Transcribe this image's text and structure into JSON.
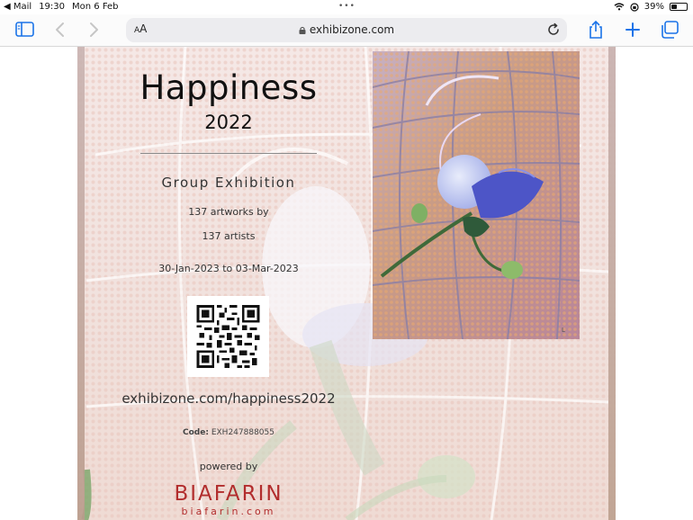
{
  "status_bar": {
    "back_app": "◀ Mail",
    "time": "19:30",
    "date": "Mon 6 Feb",
    "battery": "39%",
    "battery_level": 0.39
  },
  "toolbar": {
    "text_size_label": "AA",
    "url": "exhibizone.com"
  },
  "poster": {
    "title": "Happiness",
    "year": "2022",
    "subtitle": "Group Exhibition",
    "artworks": "137 artworks by",
    "artists": "137 artists",
    "dates": "30-Jan-2023 to 03-Mar-2023",
    "link": "exhibizone.com/happiness2022",
    "code_label": "Code:",
    "code_value": "EXH247888055",
    "powered_by": "powered by",
    "brand": "BIAFARIN",
    "brand_url": "biafarin.com"
  },
  "colors": {
    "accent": "#1a73e8",
    "brand": "#b22d2d"
  }
}
